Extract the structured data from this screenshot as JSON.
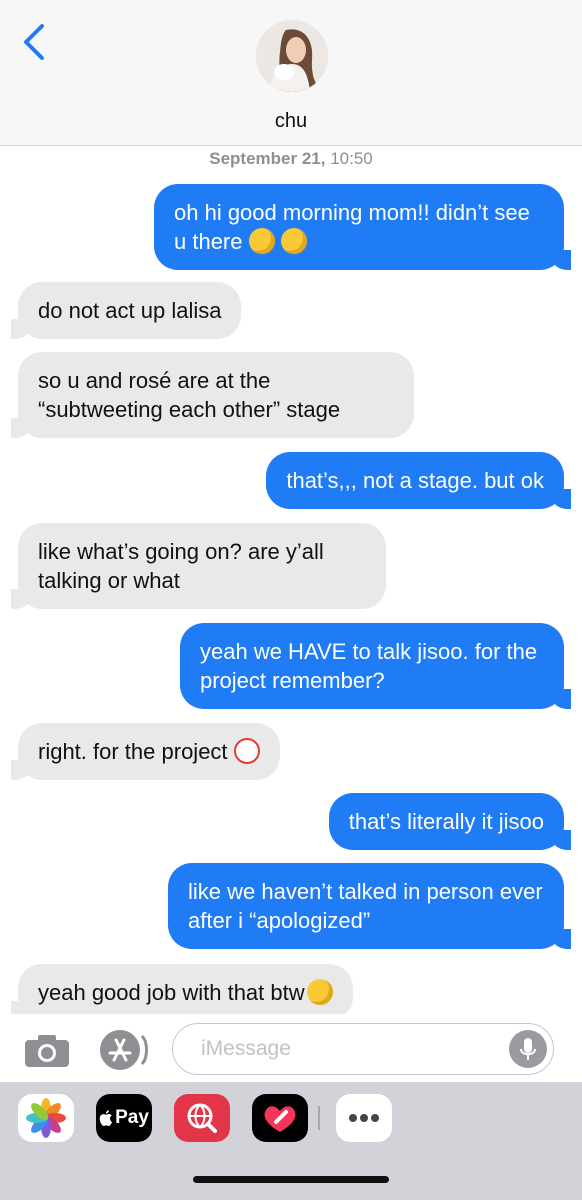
{
  "header": {
    "contact_name": "chu",
    "back_icon": "chevron-left-icon",
    "back_color": "#1f7cf5"
  },
  "thread": {
    "timestamp_date": "September 21,",
    "timestamp_time": " 10:50",
    "messages": [
      {
        "side": "sent",
        "text": "oh hi good morning mom!! didn’t see u there"
      },
      {
        "side": "received",
        "text": "do not act up lalisa"
      },
      {
        "side": "received",
        "text": "so u and rosé are at the “subtweeting each other” stage"
      },
      {
        "side": "sent",
        "text": "that’s,,, not a stage. but ok"
      },
      {
        "side": "received",
        "text": "like what’s going on? are y’all talking or what"
      },
      {
        "side": "sent",
        "text": "yeah we HAVE to talk jisoo. for the project remember?"
      },
      {
        "side": "received",
        "text": "right. for the project"
      },
      {
        "side": "sent",
        "text": "that’s literally it jisoo"
      },
      {
        "side": "sent",
        "text": "like we haven’t talked in person ever after i “apologized”"
      },
      {
        "side": "received",
        "text": "yeah good job with that btw"
      }
    ],
    "emojis": [
      "monocle-face-icon",
      "kissing-face-icon",
      "clown-face-icon",
      "eye-roll-face-icon"
    ],
    "sent_color": "#1f7cf5",
    "received_color": "#e9e9eb"
  },
  "composer": {
    "placeholder": "iMessage",
    "camera_icon": "camera-icon",
    "appstore_icon": "app-store-icon",
    "mic_icon": "microphone-icon"
  },
  "app_drawer": {
    "apple_pay_label": "Pay",
    "apps": [
      "photos-icon",
      "apple-pay-icon",
      "web-search-icon",
      "digital-touch-icon",
      "more-icon"
    ]
  }
}
